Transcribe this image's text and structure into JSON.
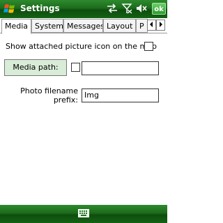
{
  "titlebar": {
    "title": "Settings",
    "ok_label": "ok"
  },
  "icons": {
    "start": "windows-start-icon",
    "connectivity": "sync-arrows-icon",
    "signal": "signal-off-icon",
    "volume": "speaker-mute-icon",
    "keyboard": "keyboard-icon"
  },
  "tabs": [
    {
      "label": "Media",
      "active": true
    },
    {
      "label": "System",
      "active": false
    },
    {
      "label": "Messages",
      "active": false
    },
    {
      "label": "Layout",
      "active": false
    },
    {
      "label": "P",
      "active": false
    }
  ],
  "content": {
    "show_picture_icon_label": "Show attached picture icon on the map",
    "show_picture_icon_checked": false,
    "media_path_button": "Media path:",
    "media_path_checked": false,
    "media_path_value": "",
    "photo_prefix_label": "Photo filename prefix:",
    "photo_prefix_value": "Img"
  },
  "colors": {
    "bar_green": "#1c6b1c",
    "button_green": "#d8ecd8"
  }
}
